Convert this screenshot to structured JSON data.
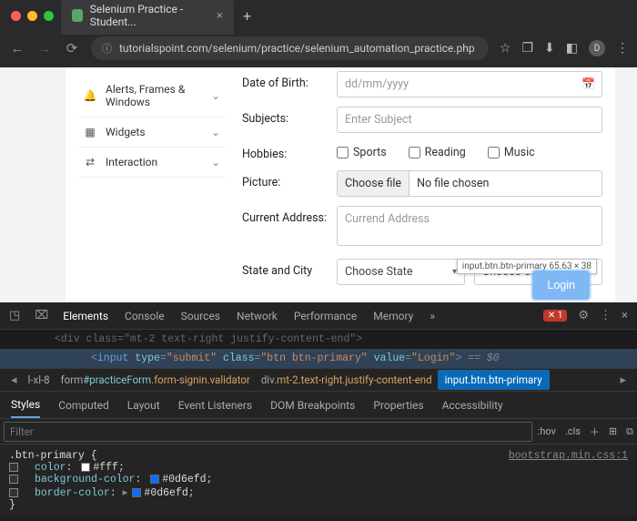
{
  "browser": {
    "tab_title": "Selenium Practice - Student...",
    "url": "tutorialspoint.com/selenium/practice/selenium_automation_practice.php",
    "avatar_letter": "D"
  },
  "sidebar": {
    "items": [
      {
        "label": "Alerts, Frames & Windows",
        "icon": "bell-icon"
      },
      {
        "label": "Widgets",
        "icon": "grid-icon"
      },
      {
        "label": "Interaction",
        "icon": "swap-icon"
      }
    ]
  },
  "form": {
    "dob_label": "Date of Birth:",
    "dob_placeholder": "dd/mm/yyyy",
    "subjects_label": "Subjects:",
    "subjects_placeholder": "Enter Subject",
    "hobbies_label": "Hobbies:",
    "hobbies": {
      "sports": "Sports",
      "reading": "Reading",
      "music": "Music"
    },
    "picture_label": "Picture:",
    "choose_file": "Choose file",
    "no_file": "No file chosen",
    "address_label": "Current Address:",
    "address_placeholder": "Currend Address",
    "statecity_label": "State and City",
    "state_placeholder": "Choose State",
    "city_placeholder": "Choose City",
    "login_label": "Login",
    "tooltip": "input.btn.btn-primary   65.63 × 38"
  },
  "devtools": {
    "tabs": [
      "Elements",
      "Console",
      "Sources",
      "Network",
      "Performance",
      "Memory"
    ],
    "active_tab": "Elements",
    "error_count": "1",
    "source_html": "<input type=\"submit\" class=\"btn btn-primary\" value=\"Login\">",
    "src_suffix": " == $0",
    "breadcrumb": {
      "prefix": "l-xl-8",
      "parts": [
        {
          "tag": "form",
          "id": "#practiceForm",
          "cls": ".form-signin.validator"
        },
        {
          "tag": "div",
          "cls": ".mt-2.text-right.justify-content-end"
        },
        {
          "tag": "input",
          "cls": ".btn.btn-primary",
          "active": true
        }
      ]
    },
    "styles_tabs": [
      "Styles",
      "Computed",
      "Layout",
      "Event Listeners",
      "DOM Breakpoints",
      "Properties",
      "Accessibility"
    ],
    "active_styles_tab": "Styles",
    "filter_placeholder": "Filter",
    "hov": ":hov",
    "cls": ".cls",
    "css_source": "bootstrap.min.css:1",
    "rule": {
      "selector": ".btn-primary {",
      "lines": [
        {
          "prop": "color",
          "val": "#fff",
          "swatch": "#ffffff"
        },
        {
          "prop": "background-color",
          "val": "#0d6efd",
          "swatch": "#0d6efd"
        },
        {
          "prop": "border-color",
          "val": "#0d6efd",
          "swatch": "#0d6efd",
          "expand": true
        }
      ],
      "close": "}"
    }
  }
}
